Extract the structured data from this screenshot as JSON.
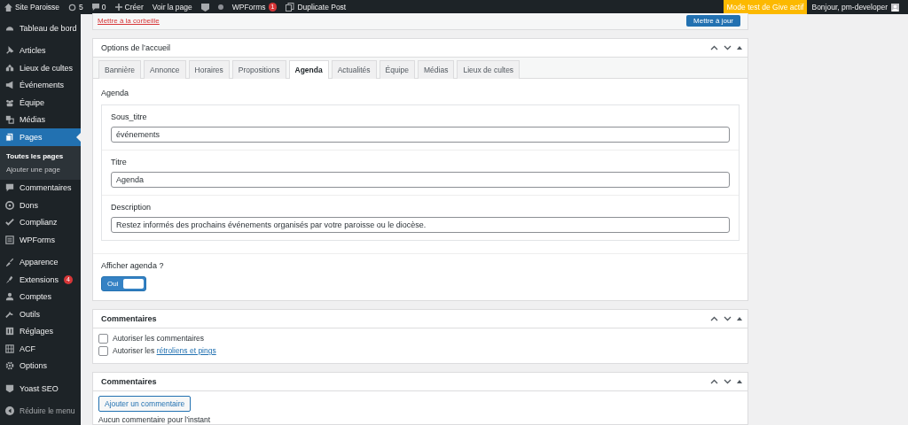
{
  "admin_bar": {
    "items": [
      {
        "kind": "site",
        "label": "Site Paroisse"
      },
      {
        "kind": "updates",
        "label": "5"
      },
      {
        "kind": "comments",
        "label": "0"
      },
      {
        "kind": "new",
        "label": "Créer"
      },
      {
        "kind": "link",
        "label": "Voir la page"
      },
      {
        "kind": "yoast"
      },
      {
        "kind": "dot"
      },
      {
        "kind": "link",
        "label": "WPForms",
        "badge": "1"
      },
      {
        "kind": "duplicate",
        "label": "Duplicate Post"
      }
    ],
    "notice": "Mode test de Give actif",
    "greeting": "Bonjour, pm-developer"
  },
  "sidebar": {
    "groups": [
      [
        {
          "label": "Tableau de bord",
          "selected": false
        }
      ],
      [
        {
          "label": "Articles",
          "selected": false
        },
        {
          "label": "Lieux de cultes",
          "selected": false
        },
        {
          "label": "Événements",
          "selected": false
        },
        {
          "label": "Équipe",
          "selected": false
        },
        {
          "label": "Médias",
          "selected": false
        },
        {
          "label": "Pages",
          "selected": true,
          "children": [
            {
              "label": "Toutes les pages",
              "selected": true
            },
            {
              "label": "Ajouter une page",
              "selected": false
            }
          ]
        },
        {
          "label": "Commentaires",
          "selected": false
        },
        {
          "label": "Dons",
          "selected": false
        },
        {
          "label": "Complianz",
          "selected": false
        },
        {
          "label": "WPForms",
          "selected": false
        }
      ],
      [
        {
          "label": "Apparence",
          "selected": false
        },
        {
          "label": "Extensions",
          "selected": false,
          "badge": "4"
        },
        {
          "label": "Comptes",
          "selected": false
        },
        {
          "label": "Outils",
          "selected": false
        },
        {
          "label": "Réglages",
          "selected": false
        },
        {
          "label": "ACF",
          "selected": false
        },
        {
          "label": "Options",
          "selected": false
        }
      ],
      [
        {
          "label": "Yoast SEO",
          "selected": false
        }
      ]
    ],
    "collapse": "Réduire le menu"
  },
  "publish_box": {
    "trash_link": "Mettre à la corbeille",
    "update_button": "Mettre à jour"
  },
  "options_panel": {
    "title": "Options de l’accueil",
    "tabs": [
      {
        "label": "Bannière",
        "selected": false
      },
      {
        "label": "Annonce",
        "selected": false
      },
      {
        "label": "Horaires",
        "selected": false
      },
      {
        "label": "Propositions",
        "selected": false
      },
      {
        "label": "Agenda",
        "selected": true
      },
      {
        "label": "Actualités",
        "selected": false
      },
      {
        "label": "Équipe",
        "selected": false
      },
      {
        "label": "Médias",
        "selected": false
      },
      {
        "label": "Lieux de cultes",
        "selected": false
      }
    ],
    "section_label": "Agenda",
    "fields": [
      {
        "label": "Sous_titre",
        "value": "événements"
      },
      {
        "label": "Titre",
        "value": "Agenda"
      },
      {
        "label": "Description",
        "value": "Restez informés des prochains événements organisés par votre paroisse ou le diocèse."
      }
    ],
    "toggle": {
      "label": "Afficher agenda ?",
      "on": true,
      "on_label": "Oui"
    }
  },
  "comments_panel": {
    "title": "Commentaires",
    "options": [
      {
        "text": "Autoriser les commentaires",
        "checked": false
      },
      {
        "text": "Autoriser les",
        "link": "rétroliens et pings",
        "checked": false
      }
    ]
  },
  "comments_list_panel": {
    "title": "Commentaires",
    "add_button": "Ajouter un commentaire",
    "empty_note": "Aucun commentaire pour l’instant"
  }
}
